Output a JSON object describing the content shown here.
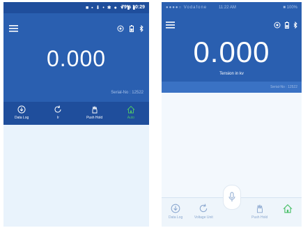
{
  "left_screen": {
    "statusbar": {
      "icons": "■ ▪ ⬇ • ✱ ● ▼ ▮ ▮",
      "battery": "79%",
      "time": "10:29"
    },
    "reading": "0.000",
    "serial": "Serial-No : 12522",
    "toolbar": [
      {
        "label": "Data Log",
        "icon": "download-circle-icon"
      },
      {
        "label": "Ir",
        "icon": "refresh-icon"
      },
      {
        "label": "Push Hold",
        "icon": "hand-icon"
      },
      {
        "label": "Auto",
        "icon": "home-icon"
      }
    ]
  },
  "right_screen": {
    "statusbar": {
      "left": "●●●●○ Vodafone",
      "time": "11:22 AM",
      "right": "■ 100%"
    },
    "reading": "0.000",
    "caption": "Tension in kv",
    "serial": "Serial-No : 12522",
    "toolbar": [
      {
        "label": "Data Log",
        "icon": "download-circle-icon"
      },
      {
        "label": "Voltage Unit",
        "icon": "refresh-icon"
      },
      {
        "label": "",
        "icon": "spacer"
      },
      {
        "label": "Push Hold",
        "icon": "hand-icon"
      },
      {
        "label": "",
        "icon": "home-icon"
      }
    ]
  },
  "colors": {
    "header_blue": "#2a5fb0",
    "dark_blue": "#1f4e9c",
    "active_green": "#4cc06b",
    "content_bg": "#e9f3fc"
  }
}
